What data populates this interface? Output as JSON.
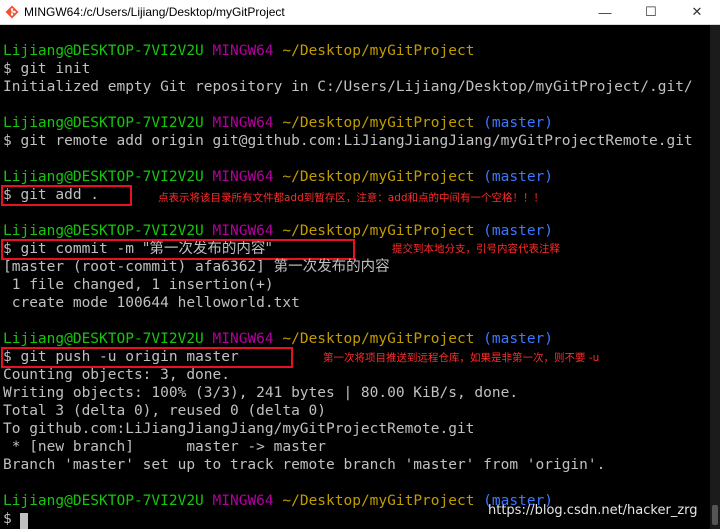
{
  "window": {
    "title": "MINGW64:/c/Users/Lijiang/Desktop/myGitProject",
    "minimize_glyph": "—",
    "maximize_glyph": "☐",
    "close_glyph": "✕"
  },
  "prompt": {
    "user": "Lijiang@DESKTOP-7VI2V2U",
    "system": "MINGW64",
    "path": "~/Desktop/myGitProject",
    "branch": "(master)",
    "symbol": "$"
  },
  "commands": {
    "init": "git init",
    "remote": "git remote add origin git@github.com:LiJiangJiangJiang/myGitProjectRemote.git",
    "add": "git add .",
    "commit_cmd": "git commit -m ",
    "commit_msg": "\"第一次发布的内容\"",
    "push": "git push -u origin master"
  },
  "output": {
    "init": "Initialized empty Git repository in C:/Users/Lijiang/Desktop/myGitProject/.git/",
    "commit_head": "[master (root-commit) afa6362] ",
    "commit_head_msg": "第一次发布的内容",
    "commit_files": " 1 file changed, 1 insertion(+)",
    "commit_mode": " create mode 100644 helloworld.txt",
    "push_counting": "Counting objects: 3, done.",
    "push_writing": "Writing objects: 100% (3/3), 241 bytes | 80.00 KiB/s, done.",
    "push_total": "Total 3 (delta 0), reused 0 (delta 0)",
    "push_to": "To github.com:LiJiangJiangJiang/myGitProjectRemote.git",
    "push_branch": " * [new branch]      master -> master",
    "push_track": "Branch 'master' set up to track remote branch 'master' from 'origin'."
  },
  "annotations": {
    "add": "点表示将该目录所有文件都add到暂存区，注意：add和点的中间有一个空格！！！",
    "commit": "提交到本地分支，引号内容代表注释",
    "push": "第一次将项目推送到远程仓库，如果是非第一次，则不要 -u"
  },
  "watermark": "https://blog.csdn.net/hacker_zrg",
  "colors": {
    "user": "#16c60c",
    "system": "#b4009e",
    "path": "#c19c00",
    "branch": "#3b78ff",
    "text": "#c0c0c0",
    "annotation": "#ff2b2b",
    "highlight_box": "#e81123",
    "background": "#000000"
  },
  "icons": {
    "app": "git-bash-icon",
    "minimize": "minimize-icon",
    "maximize": "maximize-icon",
    "close": "close-icon"
  }
}
